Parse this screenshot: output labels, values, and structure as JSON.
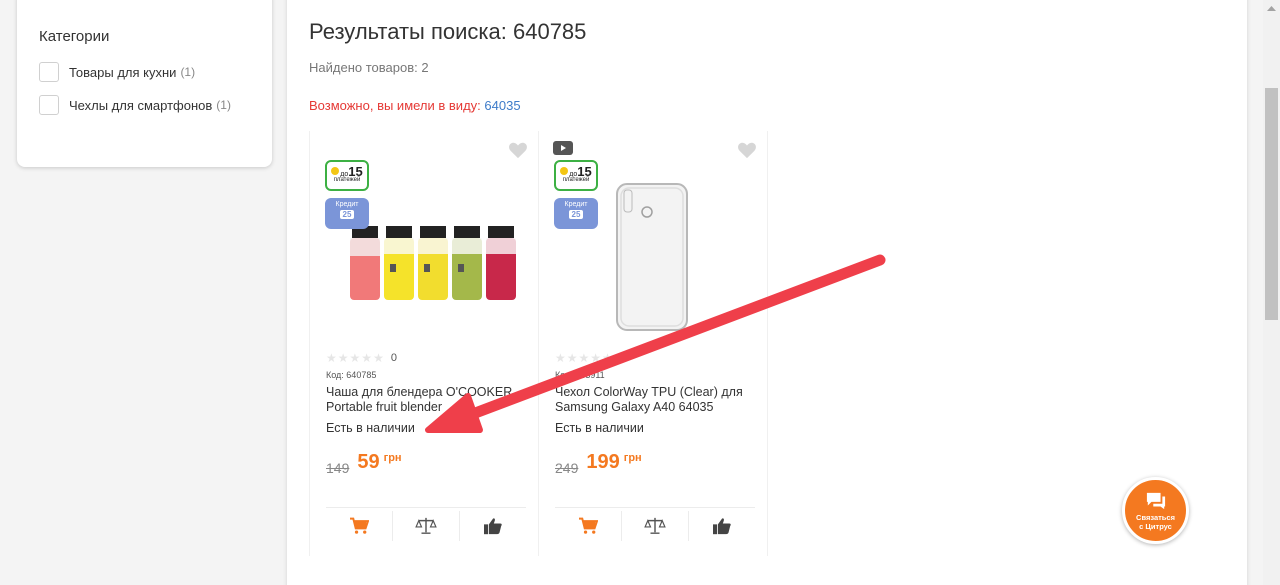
{
  "sidebar": {
    "title": "Категории",
    "items": [
      {
        "label": "Товары для кухни",
        "count": "(1)"
      },
      {
        "label": "Чехлы для смартфонов",
        "count": "(1)"
      }
    ]
  },
  "search": {
    "title": "Результаты поиска: 640785",
    "found": "Найдено товаров: 2",
    "suggest_prefix": "Возможно, вы имели в виду:",
    "suggest_link": "64035"
  },
  "badges": {
    "installment_number": "15",
    "installment_prefix": "до",
    "installment_sub": "платежей",
    "credit_label": "Кредит",
    "credit_value": "25"
  },
  "products": [
    {
      "rating_count": "0",
      "code": "Код: 640785",
      "name": "Чаша для блендера O'COOKER Portable fruit blender",
      "availability": "Есть в наличии",
      "old_price": "149",
      "price": "59",
      "currency": "грн"
    },
    {
      "rating_count": "0",
      "code": "Код: 643911",
      "name": "Чехол ColorWay TPU (Clear) для Samsung Galaxy A40 64035",
      "availability": "Есть в наличии",
      "old_price": "249",
      "price": "199",
      "currency": "грн"
    }
  ],
  "chat": {
    "line1": "Связаться",
    "line2": "с Цитрус"
  },
  "colors": {
    "accent": "#f47920",
    "suggest": "#e53935",
    "link": "#3d7bc9",
    "arrow": "#ef3f4a"
  }
}
